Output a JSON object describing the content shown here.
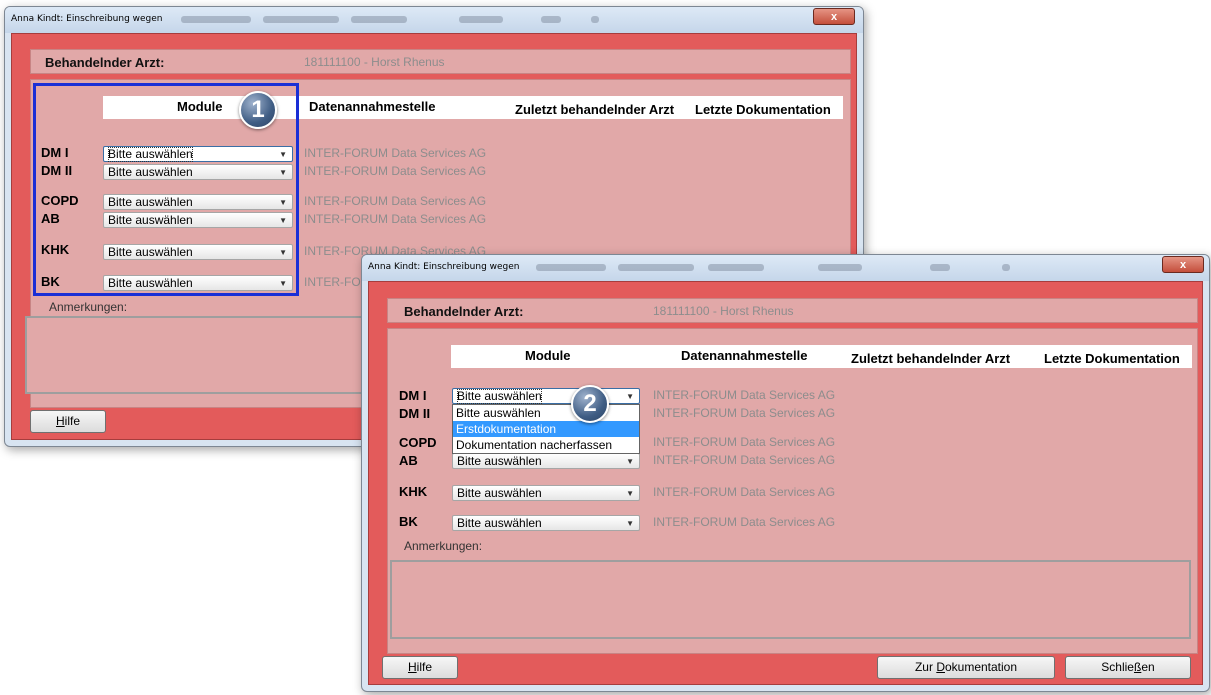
{
  "window_title": "Anna Kindt: Einschreibung wegen",
  "close_glyph": "x",
  "doctor": {
    "label": "Behandelnder Arzt:",
    "value": "181111100 - Horst Rhenus"
  },
  "columns": {
    "module": "Module",
    "dsa": "Datenannahmestelle",
    "last_doctor": "Zuletzt behandelnder Arzt",
    "last_doc": "Letzte Dokumentation"
  },
  "rows": [
    {
      "label": "DM I",
      "select": "Bitte auswählen",
      "dsa": "INTER-FORUM Data Services AG"
    },
    {
      "label": "DM II",
      "select": "Bitte auswählen",
      "dsa": "INTER-FORUM Data Services AG"
    },
    {
      "label": "COPD",
      "select": "Bitte auswählen",
      "dsa": "INTER-FORUM Data Services AG"
    },
    {
      "label": "AB",
      "select": "Bitte auswählen",
      "dsa": "INTER-FORUM Data Services AG"
    },
    {
      "label": "KHK",
      "select": "Bitte auswählen",
      "dsa": "INTER-FORUM Data Services AG"
    },
    {
      "label": "BK",
      "select": "Bitte auswählen",
      "dsa": "INTER-FORUM Data Services AG"
    }
  ],
  "window1": {
    "dsa_clipped_bk": "INTER-FO"
  },
  "dropdown_options": [
    "Bitte auswählen",
    "Erstdokumentation",
    "Dokumentation nacherfassen"
  ],
  "anmerkungen_label": "Anmerkungen:",
  "buttons": {
    "hilfe_hotkey": "H",
    "hilfe_rest": "ilfe",
    "doku_pre": "Zur ",
    "doku_hotkey": "D",
    "doku_rest": "okumentation",
    "schliessen_pre": "Schlie",
    "schliessen_hotkey": "ß",
    "schliessen_rest": "en"
  },
  "callouts": [
    "1",
    "2"
  ],
  "colors": {
    "client_bg": "#e35b5b",
    "panel_bg": "#e1a8a8",
    "highlight": "#1a2fd6",
    "dropdown_selection": "#3399ff"
  }
}
